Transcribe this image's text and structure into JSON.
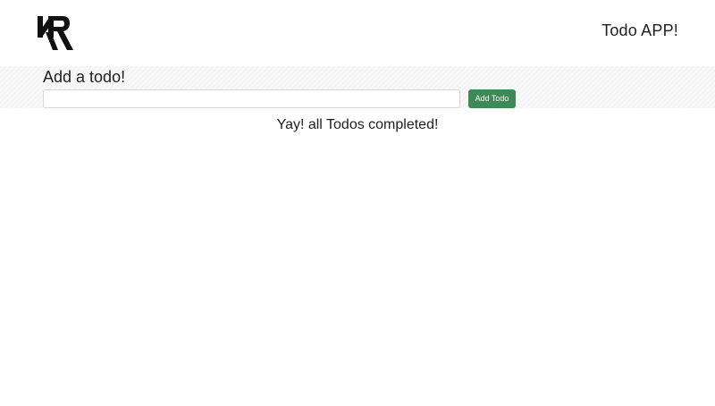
{
  "header": {
    "logo_text": "KR",
    "app_title": "Todo APP!"
  },
  "add_section": {
    "heading": "Add a todo!",
    "input_value": "",
    "input_placeholder": "",
    "button_label": "Add Todo",
    "button_color": "#3e8a56"
  },
  "todos": [],
  "empty_message": "Yay! all Todos completed!"
}
